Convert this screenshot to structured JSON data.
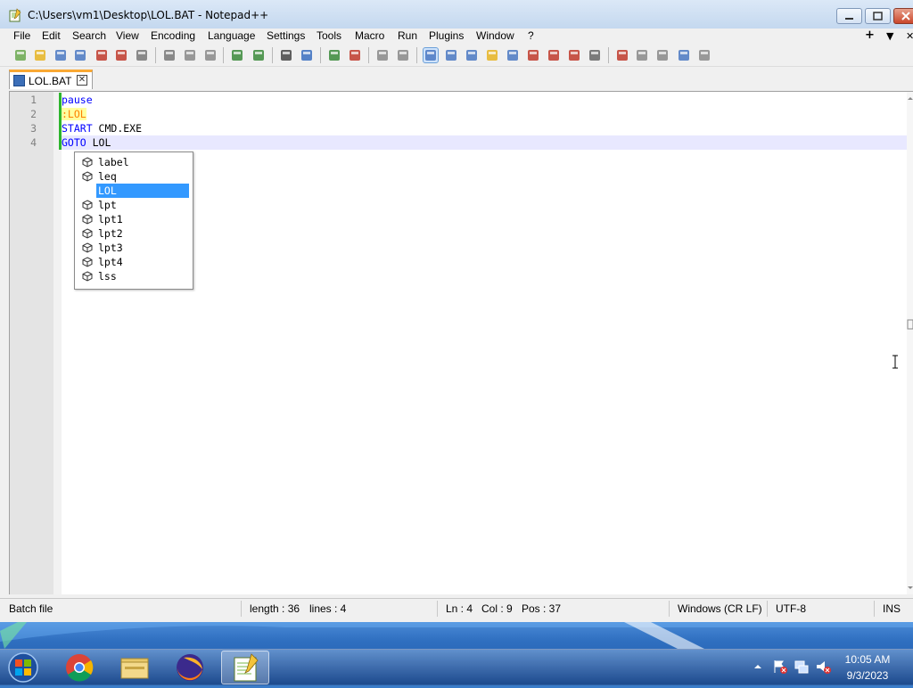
{
  "window": {
    "title": "C:\\Users\\vm1\\Desktop\\LOL.BAT - Notepad++"
  },
  "menu": {
    "items": [
      "File",
      "Edit",
      "Search",
      "View",
      "Encoding",
      "Language",
      "Settings",
      "Tools",
      "Macro",
      "Run",
      "Plugins",
      "Window",
      "?"
    ],
    "right": [
      "+",
      "▼",
      "✕"
    ]
  },
  "toolbar": {
    "icons": [
      "new-file-icon",
      "open-file-icon",
      "save-icon",
      "save-all-icon",
      "close-icon",
      "close-all-icon",
      "print-icon",
      "cut-icon",
      "copy-icon",
      "paste-icon",
      "undo-icon",
      "redo-icon",
      "find-icon",
      "replace-icon",
      "zoom-in-icon",
      "zoom-out-icon",
      "sync-vertical-icon",
      "sync-horizontal-icon",
      "word-wrap-icon",
      "show-all-chars-icon",
      "indent-guide-icon",
      "language-udl-icon",
      "doc-map-icon",
      "function-list-icon",
      "folder-workspace-icon",
      "doc-switcher-icon",
      "monitor-icon",
      "record-macro-icon",
      "stop-record-icon",
      "play-macro-icon",
      "play-multiple-icon",
      "save-macro-icon"
    ]
  },
  "tab": {
    "label": "LOL.BAT",
    "close": "✕"
  },
  "editor": {
    "lines": [
      {
        "num": "1",
        "text": "pause"
      },
      {
        "num": "2",
        "text": ":LOL"
      },
      {
        "num": "3",
        "kw": "START",
        "rest": " CMD.EXE"
      },
      {
        "num": "4",
        "kw": "GOTO",
        "rest": " LOL"
      }
    ]
  },
  "autocomplete": {
    "items": [
      "label",
      "leq",
      "LOL",
      "lpt",
      "lpt1",
      "lpt2",
      "lpt3",
      "lpt4",
      "lss"
    ],
    "selected": "LOL"
  },
  "status": {
    "language": "Batch file",
    "length": "length : 36",
    "lines": "lines : 4",
    "ln": "Ln : 4",
    "col": "Col : 9",
    "pos": "Pos : 37",
    "eol": "Windows (CR LF)",
    "encoding": "UTF-8",
    "mode": "INS"
  },
  "taskbar": {
    "apps": [
      "chrome-icon",
      "explorer-icon",
      "firefox-icon",
      "notepadpp-icon"
    ],
    "time": "10:05 AM",
    "date": "9/3/2023"
  },
  "colors": {
    "keyword": "#0000ff",
    "label": "#ff8000",
    "selection": "#3399ff",
    "current_line": "#e8e8ff",
    "tab_accent": "#f9a833"
  }
}
